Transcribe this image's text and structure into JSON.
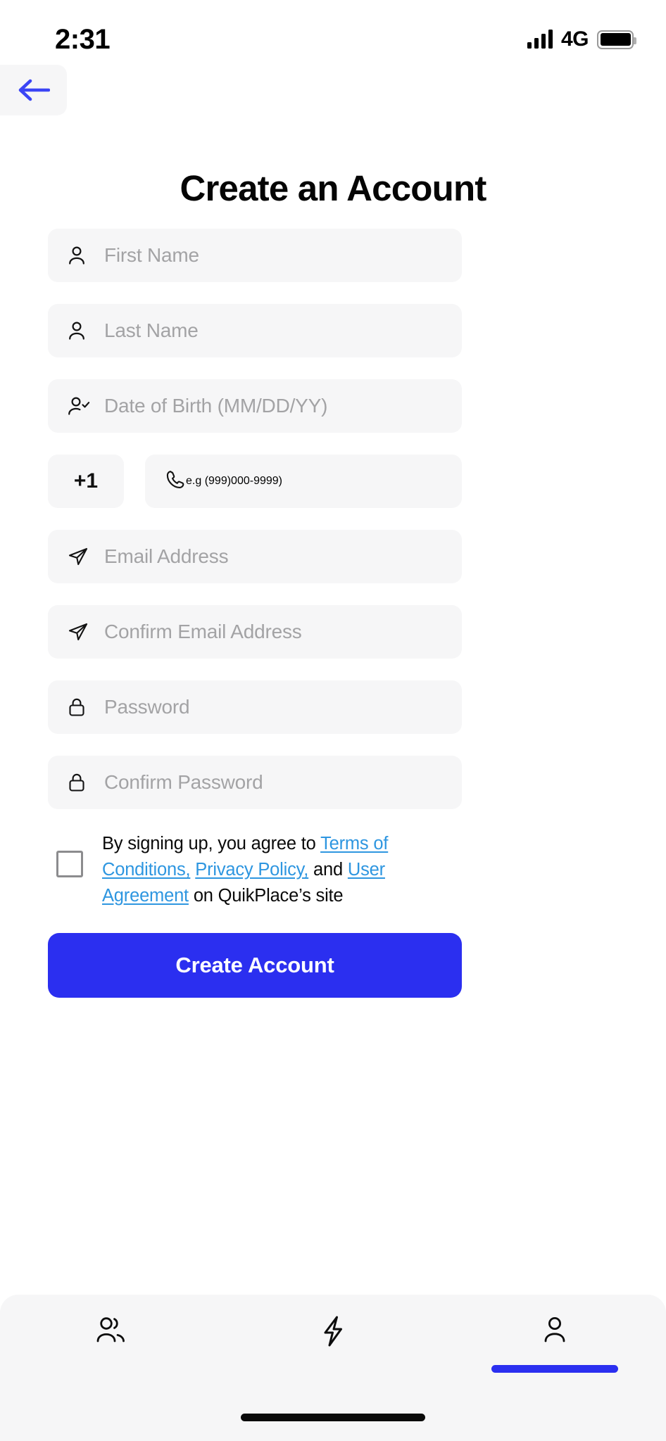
{
  "status_bar": {
    "time": "2:31",
    "network": "4G",
    "signal_icon": "signal-bars-icon",
    "battery_icon": "battery-full-icon"
  },
  "header": {
    "back_icon": "arrow-left-icon",
    "title": "Create an Account"
  },
  "form": {
    "fields": [
      {
        "name": "first-name",
        "icon": "person-icon",
        "placeholder": "First Name"
      },
      {
        "name": "last-name",
        "icon": "person-icon",
        "placeholder": "Last Name"
      },
      {
        "name": "date-of-birth",
        "icon": "person-check-icon",
        "placeholder": "Date of Birth (MM/DD/YY)"
      }
    ],
    "phone": {
      "country_code": "+1",
      "icon": "phone-icon",
      "placeholder": "e.g (999)000-9999)"
    },
    "fields2": [
      {
        "name": "email-address",
        "icon": "send-icon",
        "placeholder": "Email Address"
      },
      {
        "name": "confirm-email-address",
        "icon": "send-icon",
        "placeholder": "Confirm Email Address"
      },
      {
        "name": "password",
        "icon": "lock-icon",
        "placeholder": "Password"
      },
      {
        "name": "confirm-password",
        "icon": "lock-icon",
        "placeholder": "Confirm Password"
      }
    ]
  },
  "terms": {
    "checked": false,
    "lead": "By signing up, you agree to ",
    "link_terms": "Terms of Conditions,",
    "sep1": " ",
    "link_privacy": "Privacy Policy,",
    "sep2": " and ",
    "link_user_agreement": "User Agreement",
    "tail": " on QuikPlace’s site"
  },
  "submit": {
    "label": "Create Account"
  },
  "bottom_nav": {
    "items": [
      {
        "name": "nav-people",
        "icon": "users-icon",
        "active": false
      },
      {
        "name": "nav-flash",
        "icon": "lightning-icon",
        "active": false
      },
      {
        "name": "nav-profile",
        "icon": "person-icon",
        "active": true
      }
    ]
  },
  "colors": {
    "accent": "#2b2ff0",
    "link": "#2e96e0",
    "field_bg": "#f6f6f7",
    "placeholder": "#a3a3a5"
  }
}
